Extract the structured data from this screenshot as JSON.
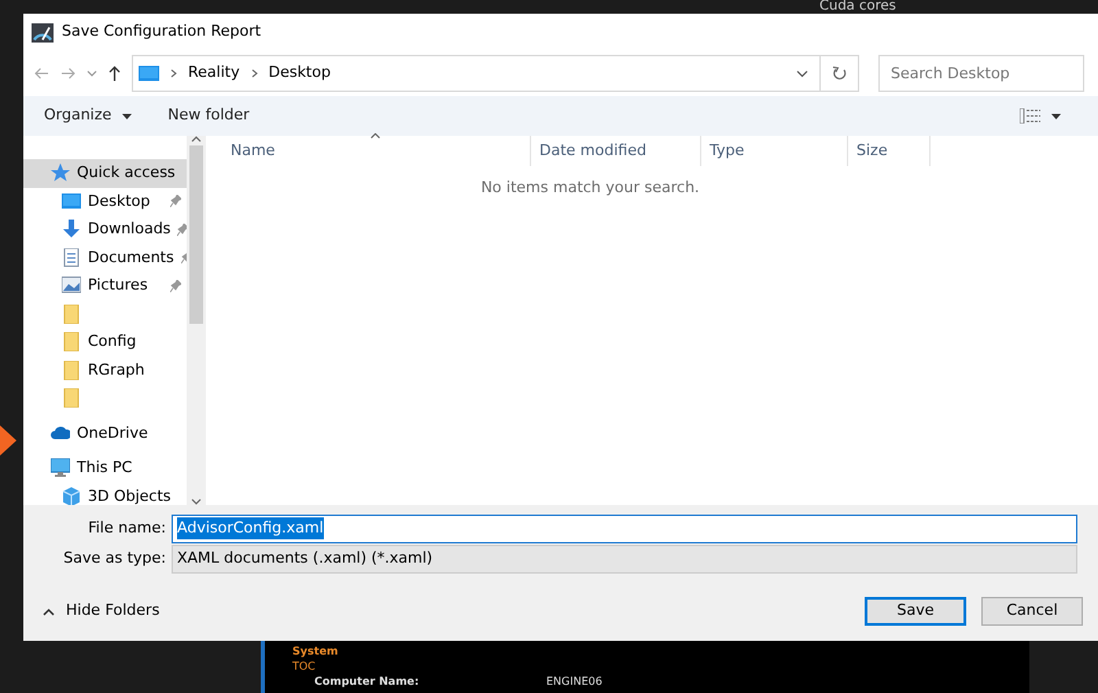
{
  "background_app": {
    "heading": "Cuda cores",
    "section": "System",
    "link": "TOC",
    "rows": [
      {
        "label": "Computer Name:",
        "value": "ENGINE06"
      }
    ]
  },
  "window": {
    "title": "Save Configuration Report"
  },
  "address_bar": {
    "path": [
      "Reality",
      "Desktop"
    ]
  },
  "search": {
    "placeholder": "Search Desktop"
  },
  "toolbar": {
    "organize": "Organize",
    "new_folder": "New folder"
  },
  "columns": [
    {
      "label": "Name",
      "sorted": true
    },
    {
      "label": "Date modified",
      "sorted": false
    },
    {
      "label": "Type",
      "sorted": false
    },
    {
      "label": "Size",
      "sorted": false
    }
  ],
  "empty_message": "No items match your search.",
  "sidebar": {
    "items": [
      {
        "label": "Quick access",
        "kind": "star",
        "selected": true,
        "children": [
          {
            "label": "Desktop",
            "kind": "desktop",
            "pinned": true,
            "selected": false
          },
          {
            "label": "Downloads",
            "kind": "download",
            "pinned": true,
            "selected": false
          },
          {
            "label": "Documents",
            "kind": "document",
            "pinned": true,
            "selected": false
          },
          {
            "label": "Pictures",
            "kind": "picture",
            "pinned": true,
            "selected": false
          },
          {
            "kind": "folder",
            "pinned": false,
            "selected": false
          },
          {
            "label": "Config",
            "kind": "folder",
            "pinned": false,
            "selected": false
          },
          {
            "label": "RGraph",
            "kind": "folder",
            "pinned": false,
            "selected": false
          },
          {
            "kind": "folder",
            "pinned": false,
            "selected": false
          }
        ]
      },
      {
        "label": "OneDrive",
        "kind": "cloud",
        "selected": false
      },
      {
        "label": "This PC",
        "kind": "pc",
        "selected": false,
        "children": [
          {
            "label": "3D Objects",
            "kind": "cube",
            "selected": false
          }
        ]
      }
    ]
  },
  "file_name": {
    "label": "File name:",
    "value": "AdvisorConfig.xaml",
    "text_selected": true
  },
  "save_as_type": {
    "label": "Save as type:",
    "value": "XAML documents (.xaml) (*.xaml)"
  },
  "hide_folders": "Hide Folders",
  "buttons": [
    {
      "label": "Save",
      "default": true
    },
    {
      "label": "Cancel",
      "default": false
    }
  ]
}
